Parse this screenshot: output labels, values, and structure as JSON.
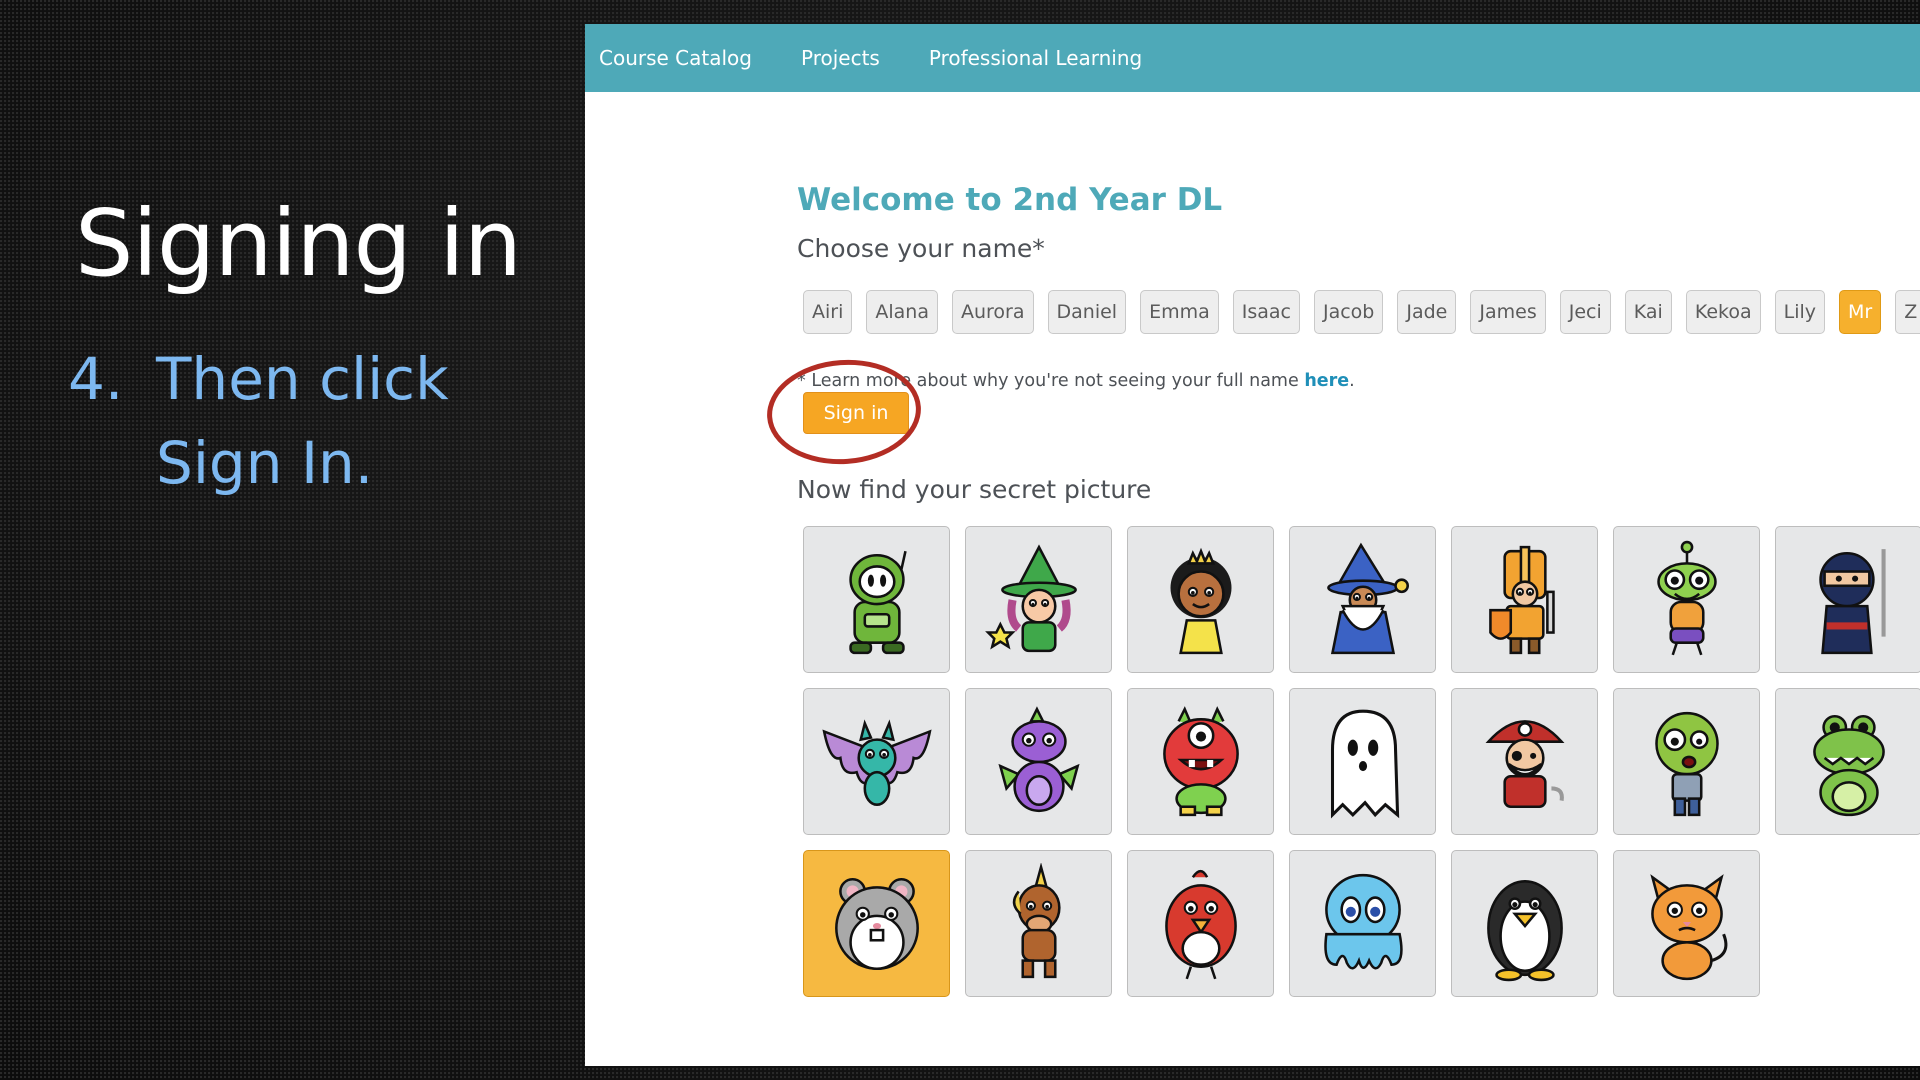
{
  "slide": {
    "title": "Signing in",
    "step_number": "4.",
    "step_line1": "Then click",
    "step_line2": "Sign In."
  },
  "nav": {
    "items": [
      {
        "label": "Course Catalog"
      },
      {
        "label": "Projects"
      },
      {
        "label": "Professional Learning"
      }
    ]
  },
  "page": {
    "welcome": "Welcome to 2nd Year DL",
    "choose_name": "Choose your name*",
    "learn_prefix": "* Learn more about why you're not seeing your full name ",
    "learn_link": "here",
    "learn_suffix": ".",
    "signin_label": "Sign in",
    "find_picture": "Now find your secret picture"
  },
  "names": [
    "Airi",
    "Alana",
    "Aurora",
    "Daniel",
    "Emma",
    "Isaac",
    "Jacob",
    "Jade",
    "James",
    "Jeci",
    "Kai",
    "Kekoa",
    "Lily",
    "Mr",
    "Z"
  ],
  "selected_name": "Mr",
  "pictures": [
    {
      "icon": "robot-icon",
      "color": "#6fb63b"
    },
    {
      "icon": "witch-icon",
      "color": "#3fa84a"
    },
    {
      "icon": "princess-icon",
      "color": "#f4e24a"
    },
    {
      "icon": "wizard-icon",
      "color": "#3b62c4"
    },
    {
      "icon": "knight-icon",
      "color": "#f2a331"
    },
    {
      "icon": "alien-icon",
      "color": "#8fd14f"
    },
    {
      "icon": "ninja-icon",
      "color": "#1f2d5a"
    },
    {
      "icon": "bat-icon",
      "color": "#b98ad6"
    },
    {
      "icon": "dragon-icon",
      "color": "#9b5fd4"
    },
    {
      "icon": "monster-icon",
      "color": "#e23b3b"
    },
    {
      "icon": "ghost-icon",
      "color": "#ffffff"
    },
    {
      "icon": "pirate-icon",
      "color": "#c0302b"
    },
    {
      "icon": "zombie-icon",
      "color": "#8fc542"
    },
    {
      "icon": "frog-icon",
      "color": "#7fc24a"
    },
    {
      "icon": "hamster-icon",
      "color": "#a9a9a9"
    },
    {
      "icon": "unicorn-icon",
      "color": "#b0642e"
    },
    {
      "icon": "bird-icon",
      "color": "#d83a2e"
    },
    {
      "icon": "octopus-icon",
      "color": "#6cc6ec"
    },
    {
      "icon": "penguin-icon",
      "color": "#2a2a2a"
    },
    {
      "icon": "cat-icon",
      "color": "#f29a3a"
    }
  ],
  "selected_picture": "hamster-icon",
  "colors": {
    "nav_bg": "#4ea9b8",
    "accent_teal": "#4ea9b8",
    "signin_orange": "#f6a623",
    "highlight_ring": "#b32d24",
    "step_text": "#7db8f0"
  }
}
